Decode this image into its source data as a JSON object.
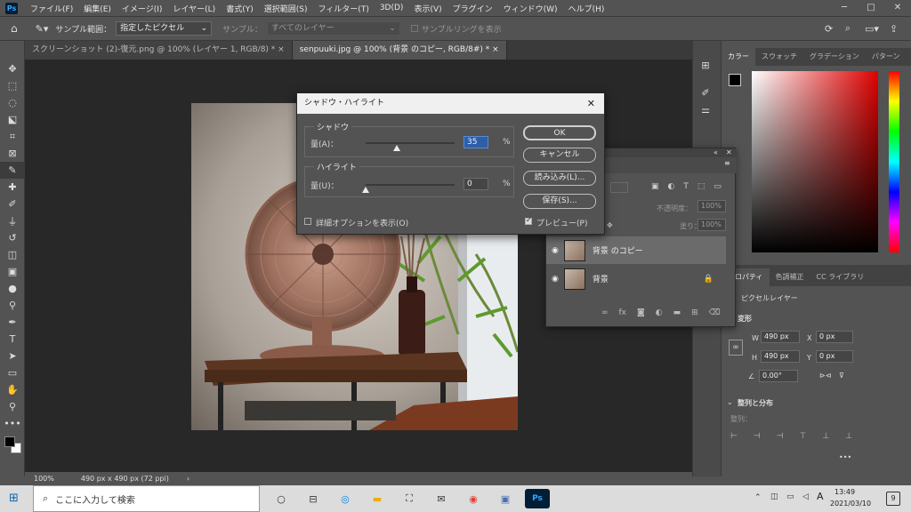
{
  "app": {
    "logo": "Ps"
  },
  "menu": [
    "ファイル(F)",
    "編集(E)",
    "イメージ(I)",
    "レイヤー(L)",
    "書式(Y)",
    "選択範囲(S)",
    "フィルター(T)",
    "3D(D)",
    "表示(V)",
    "プラグイン",
    "ウィンドウ(W)",
    "ヘルプ(H)"
  ],
  "window_buttons": {
    "minimize": "─",
    "maximize": "□",
    "close": "✕"
  },
  "options": {
    "sample_size_label": "サンプル範囲：",
    "sample_size_value": "指定したピクセル",
    "sample_label": "サンプル：",
    "sample_value": "すべてのレイヤー",
    "show_ring_label": "サンプルリングを表示"
  },
  "doc_tabs": [
    {
      "label": "スクリーンショット (2)-復元.png @ 100% (レイヤー 1, RGB/8) *",
      "close": "×"
    },
    {
      "label": "senpuuki.jpg @ 100% (背景 のコピー, RGB/8#) *",
      "close": "×"
    }
  ],
  "status": {
    "zoom": "100%",
    "doc_info": "490 px x 490 px (72 ppi)",
    "arrow": "›"
  },
  "dialog": {
    "title": "シャドウ・ハイライト",
    "close": "✕",
    "shadow_group": "シャドウ",
    "shadow_amount_label": "量(A)：",
    "shadow_amount": "35",
    "percent": "%",
    "highlight_group": "ハイライト",
    "highlight_amount_label": "量(U)：",
    "highlight_amount": "0",
    "more_options": "詳細オプションを表示(O)",
    "ok": "OK",
    "cancel": "キャンセル",
    "load": "読み込み(L)...",
    "save": "保存(S)...",
    "preview": "プレビュー(P)",
    "shadow_fraction": 0.35,
    "highlight_fraction": 0.0
  },
  "color_panel": {
    "tabs": [
      "カラー",
      "スウォッチ",
      "グラデーション",
      "パターン"
    ],
    "fg": "#000000",
    "bg": "#ffffff"
  },
  "layers_panel": {
    "opacity_label": "不透明度：",
    "opacity_value": "100%",
    "fill_label": "塗り：",
    "fill_value": "100%",
    "layers": [
      {
        "name": "背景 のコピー",
        "selected": true
      },
      {
        "name": "背景",
        "locked": true
      }
    ],
    "footer_icons": [
      "link-icon",
      "fx-icon",
      "mask-icon",
      "adjustment-icon",
      "folder-icon",
      "new-layer-icon",
      "trash-icon"
    ]
  },
  "properties": {
    "tabs": [
      "プロパティ",
      "色調補正",
      "CC ライブラリ"
    ],
    "kind": "ピクセルレイヤー",
    "transform_label": "変形",
    "w_label": "W",
    "w_value": "490 px",
    "x_label": "X",
    "x_value": "0 px",
    "h_label": "H",
    "h_value": "490 px",
    "y_label": "Y",
    "y_value": "0 px",
    "angle": "0.00°",
    "align_section": "整列と分布",
    "align_label": "整列：",
    "more": "•••"
  },
  "taskbar": {
    "search_placeholder": "ここに入力して検索",
    "time": "13:49",
    "date": "2021/03/10",
    "ime": "A",
    "notify_count": "9"
  }
}
